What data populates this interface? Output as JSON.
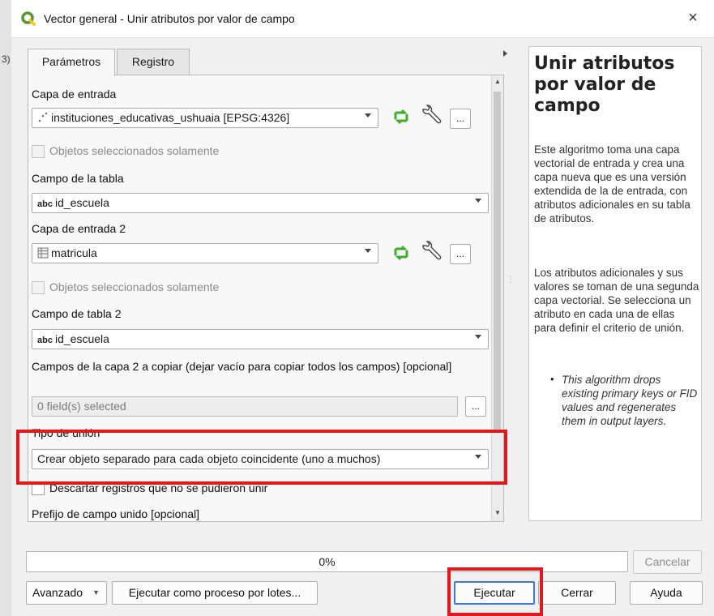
{
  "background_fragment": "3)",
  "window": {
    "title": "Vector general - Unir atributos por valor de campo",
    "close": "×"
  },
  "tabs": [
    {
      "label": "Parámetros"
    },
    {
      "label": "Registro"
    }
  ],
  "params": {
    "layer1_label": "Capa de entrada",
    "layer1_value": "instituciones_educativas_ushuaia [EPSG:4326]",
    "selected_only_1": "Objetos seleccionados solamente",
    "field1_label": "Campo de la tabla",
    "field1_prefix": "abc",
    "field1_value": "id_escuela",
    "layer2_label": "Capa de entrada 2",
    "layer2_value": "matricula",
    "selected_only_2": "Objetos seleccionados solamente",
    "field2_label": "Campo de tabla 2",
    "field2_prefix": "abc",
    "field2_value": "id_escuela",
    "copy_fields_label": "Campos de la capa 2 a copiar (dejar vacío para copiar todos los campos) [opcional]",
    "copy_fields_value": "0 field(s) selected",
    "join_type_label": "Tipo de unión",
    "join_type_value": "Crear objeto separado para cada objeto coincidente (uno a muchos)",
    "discard_label": "Descartar registros que no se pudieron unir",
    "prefix_label": "Prefijo de campo unido [opcional]",
    "dots": "..."
  },
  "help": {
    "title": "Unir atributos por valor de campo",
    "p1": "Este algoritmo toma una capa vectorial de entrada y crea una capa nueva que es una versión extendida de la de entrada, con atributos adicionales en su tabla de atributos.",
    "p2": "Los atributos adicionales y sus valores se toman de una segunda capa vectorial. Se selecciona un atributo en cada una de ellas para definir el criterio de unión.",
    "bullet": "•",
    "note": "This algorithm drops existing primary keys or FID values and regenerates them in output layers."
  },
  "footer": {
    "progress_text": "0%",
    "progress_value": 0,
    "cancel": "Cancelar",
    "advanced": "Avanzado",
    "batch": "Ejecutar como proceso por lotes...",
    "run": "Ejecutar",
    "close": "Cerrar",
    "help": "Ayuda"
  },
  "colors": {
    "highlight": "#e0191f",
    "refresh_icon": "#3fae2a",
    "qgis": "#589632"
  }
}
